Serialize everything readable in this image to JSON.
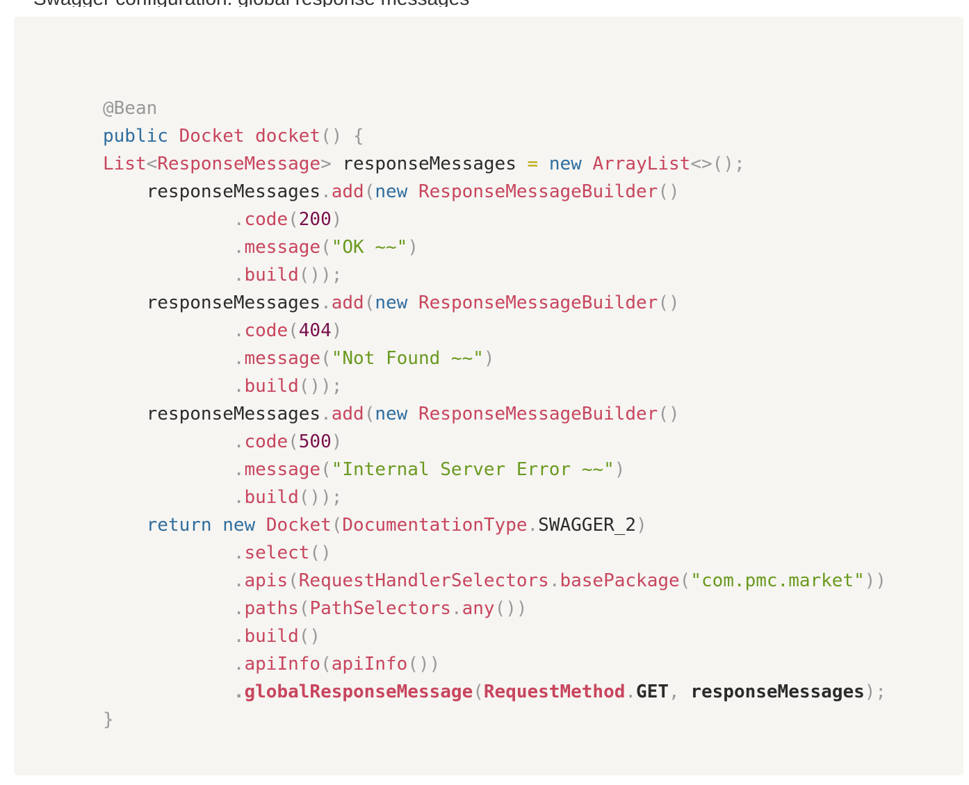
{
  "top_fragment": "Swagger configuration: global response messages",
  "code": {
    "language": "java",
    "annotation": "@Bean",
    "method_modifier": "public",
    "return_type": "Docket",
    "method_name": "docket",
    "list_type": "List",
    "generic_type": "ResponseMessage",
    "list_var": "responseMessages",
    "keyword_new": "new",
    "impl_type": "ArrayList",
    "diamond": "<>",
    "add_method": "add",
    "builder_type": "ResponseMessageBuilder",
    "code_method": "code",
    "message_method": "message",
    "build_method": "build",
    "responses": [
      {
        "code": "200",
        "message": "\"OK ~~\""
      },
      {
        "code": "404",
        "message": "\"Not Found ~~\""
      },
      {
        "code": "500",
        "message": "\"Internal Server Error ~~\""
      }
    ],
    "keyword_return": "return",
    "doc_type_class": "DocumentationType",
    "doc_type_value": "SWAGGER_2",
    "select_method": "select",
    "apis_method": "apis",
    "rhs_class": "RequestHandlerSelectors",
    "base_package_method": "basePackage",
    "base_package_value": "\"com.pmc.market\"",
    "paths_method": "paths",
    "path_selectors_class": "PathSelectors",
    "any_method": "any",
    "api_info_method": "apiInfo",
    "global_response_method": "globalResponseMessage",
    "request_method_class": "RequestMethod",
    "request_method_value": "GET",
    "closing_brace": "}"
  },
  "colors": {
    "background": "#f6f5f2",
    "keyword": "#2f6d9e",
    "type": "#c8455d",
    "number": "#7a0e4b",
    "string": "#6a9a1f",
    "punctuation": "#999999",
    "identifier": "#2b2b2b"
  }
}
